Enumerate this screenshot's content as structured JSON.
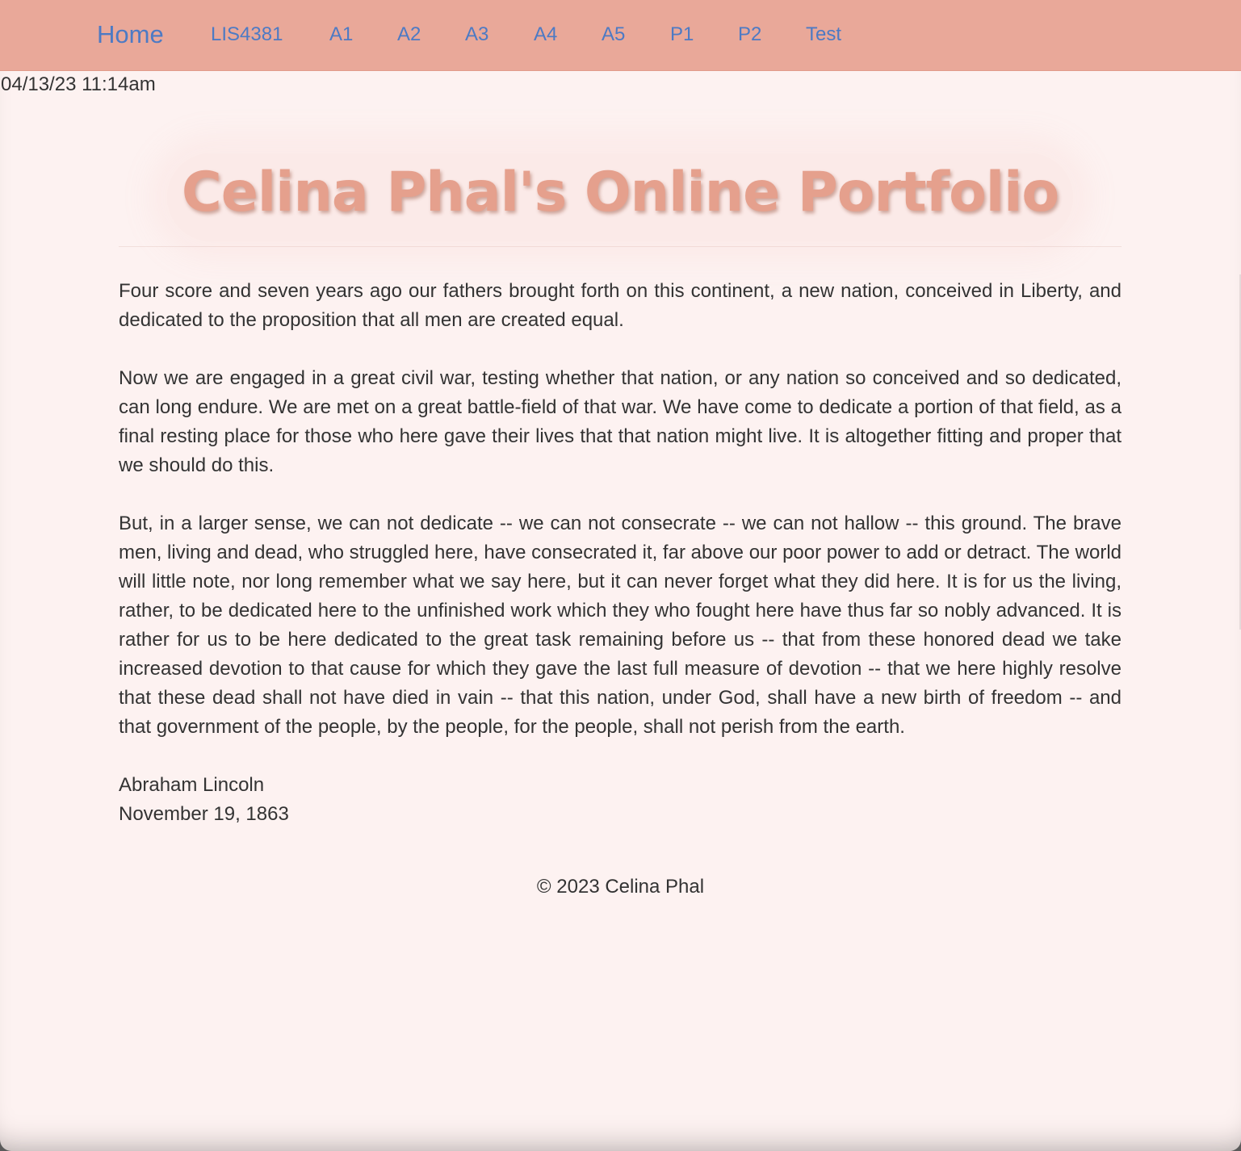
{
  "nav": {
    "brand": "Home",
    "links": [
      "LIS4381",
      "A1",
      "A2",
      "A3",
      "A4",
      "A5",
      "P1",
      "P2",
      "Test"
    ]
  },
  "timestamp": "04/13/23 11:14am",
  "header": {
    "title": "Celina Phal's Online Portfolio"
  },
  "content": {
    "paragraphs": [
      "Four score and seven years ago our fathers brought forth on this continent, a new nation, conceived in Liberty, and dedicated to the proposition that all men are created equal.",
      "Now we are engaged in a great civil war, testing whether that nation, or any nation so conceived and so dedicated, can long endure. We are met on a great battle-field of that war. We have come to dedicate a portion of that field, as a final resting place for those who here gave their lives that that nation might live. It is altogether fitting and proper that we should do this.",
      "But, in a larger sense, we can not dedicate -- we can not consecrate -- we can not hallow -- this ground. The brave men, living and dead, who struggled here, have consecrated it, far above our poor power to add or detract. The world will little note, nor long remember what we say here, but it can never forget what they did here. It is for us the living, rather, to be dedicated here to the unfinished work which they who fought here have thus far so nobly advanced. It is rather for us to be here dedicated to the great task remaining before us -- that from these honored dead we take increased devotion to that cause for which they gave the last full measure of devotion -- that we here highly resolve that these dead shall not have died in vain -- that this nation, under God, shall have a new birth of freedom -- and that government of the people, by the people, for the people, shall not perish from the earth."
    ],
    "author": "Abraham Lincoln",
    "date": "November 19, 1863"
  },
  "footer": {
    "copyright": "© 2023 Celina Phal"
  },
  "colors": {
    "navbar_bg": "#e9a899",
    "link": "#4d7ac4",
    "title": "#e5a08d",
    "page_bg": "#fdf2f1",
    "text": "#333333"
  }
}
